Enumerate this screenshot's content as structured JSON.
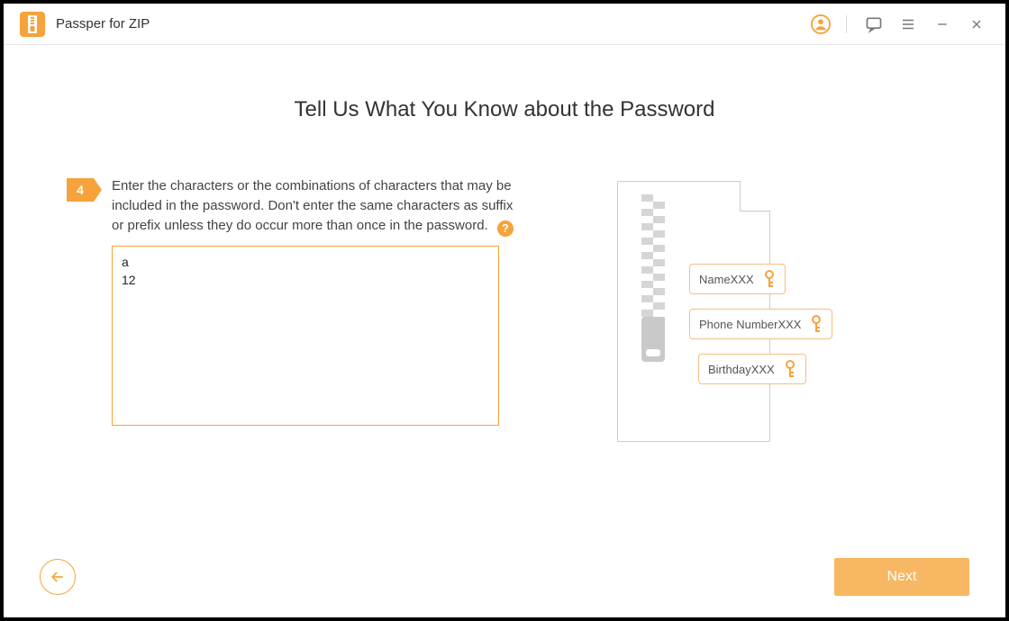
{
  "app": {
    "title": "Passper for ZIP"
  },
  "page": {
    "heading": "Tell Us What You Know about the Password",
    "step_number": "4",
    "instruction": "Enter the characters or the combinations of characters that may be included in the password. Don't enter the same characters as suffix or prefix unless they do occur more than once in the password.",
    "help_symbol": "?",
    "input_value": "a\n12"
  },
  "illustration": {
    "tag1": "NameXXX",
    "tag2": "Phone NumberXXX",
    "tag3": "BirthdayXXX"
  },
  "footer": {
    "next": "Next"
  }
}
